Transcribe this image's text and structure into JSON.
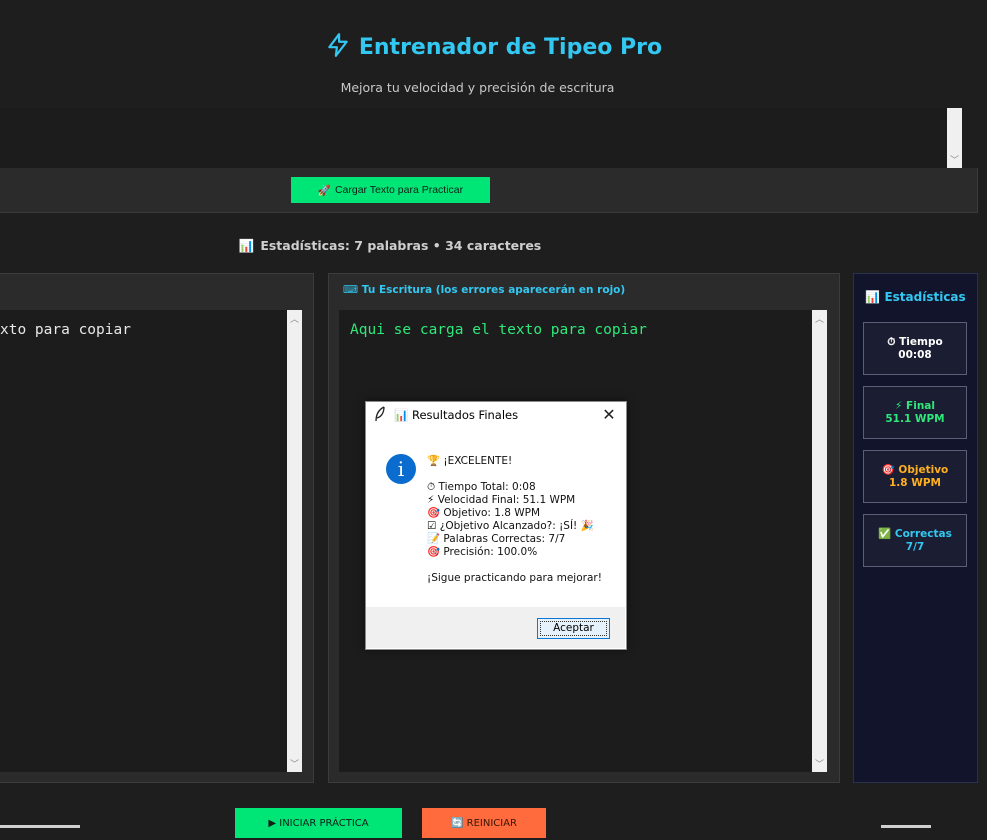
{
  "header": {
    "title": "Entrenador de Tipeo Pro",
    "subtitle": "Mejora tu velocidad y precisión de escritura"
  },
  "load_button": {
    "icon": "🚀",
    "label": "Cargar Texto para Practicar"
  },
  "summary": {
    "icon": "📊",
    "text": "Estadísticas: 7 palabras • 34 caracteres"
  },
  "source_panel": {
    "text": "xto para copiar"
  },
  "typing_panel": {
    "label": "⌨ Tu Escritura (los errores aparecerán en rojo)",
    "text": "Aqui se carga el texto para copiar"
  },
  "sidebar": {
    "title": "📊 Estadísticas",
    "cards": [
      {
        "label": "⏱ Tiempo",
        "value": "00:08",
        "color": "#ffffff"
      },
      {
        "label": "⚡ Final",
        "value": "51.1 WPM",
        "color": "#2ee87a"
      },
      {
        "label": "🎯 Objetivo",
        "value": "1.8 WPM",
        "color": "#ffb020"
      },
      {
        "label": "✅ Correctas",
        "value": "7/7",
        "color": "#33c8f2"
      }
    ]
  },
  "buttons": {
    "start": "▶ INICIAR PRÁCTICA",
    "reset": "🔄 REINICIAR"
  },
  "dialog": {
    "title": "📊 Resultados Finales",
    "body": "🏆 ¡EXCELENTE!\n\n⏱ Tiempo Total: 0:08\n⚡ Velocidad Final: 51.1 WPM\n🎯 Objetivo: 1.8 WPM\n☑ ¿Objetivo Alcanzado?: ¡SÍ! 🎉\n📝 Palabras Correctas: 7/7\n🎯 Precisión: 100.0%\n\n¡Sigue practicando para mejorar!",
    "ok": "Aceptar"
  },
  "colors": {
    "accent": "#33c8f2",
    "green": "#00e676",
    "orange": "#ff6b3d"
  }
}
